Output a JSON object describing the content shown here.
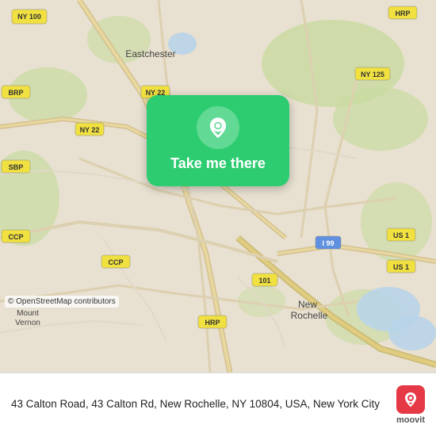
{
  "map": {
    "alt": "Map of New Rochelle, NY area",
    "osm_attribution": "© OpenStreetMap contributors"
  },
  "cta": {
    "label": "Take me there",
    "pin_icon": "location-pin"
  },
  "bottom": {
    "address": "43 Calton Road, 43 Calton Rd, New Rochelle, NY 10804, USA, New York City"
  },
  "moovit": {
    "brand": "moovit",
    "icon": "moovit-logo"
  },
  "badges": {
    "hrp": "HRP",
    "ny22": "NY 22",
    "ny125": "NY 125",
    "ny22b": "NY 22",
    "brp": "BRP",
    "sbp": "SBP",
    "ccp": "CCP",
    "ccp2": "CCP",
    "us1": "US 1",
    "us1b": "US 1",
    "i99": "I 99",
    "i101": "101",
    "hrp2": "HRP",
    "ny100": "NY 100"
  }
}
